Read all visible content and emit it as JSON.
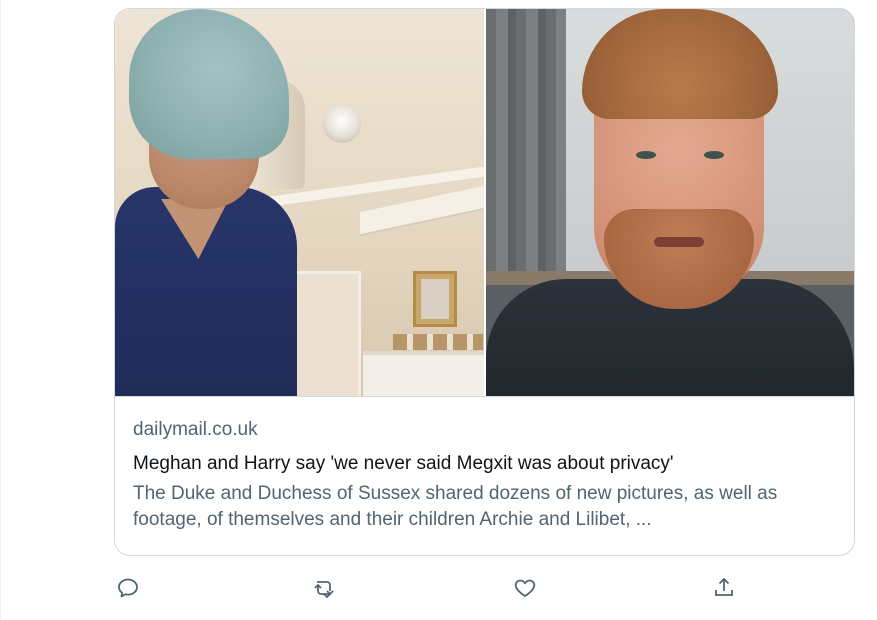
{
  "tweet": {
    "card": {
      "domain": "dailymail.co.uk",
      "headline": "Meghan and Harry say 'we never said Megxit was about privacy'",
      "description": "The Duke and Duchess of Sussex shared dozens of new pictures, as well as footage, of themselves and their children Archie and Lilibet, ...",
      "images": [
        {
          "semantic": "woman-with-towel-photo"
        },
        {
          "semantic": "man-with-beard-photo"
        }
      ]
    },
    "actions": [
      {
        "name": "reply",
        "icon": "reply-icon"
      },
      {
        "name": "retweet",
        "icon": "retweet-icon"
      },
      {
        "name": "like",
        "icon": "heart-icon"
      },
      {
        "name": "share",
        "icon": "share-icon"
      }
    ]
  },
  "colors": {
    "border": "#cfd9de",
    "secondary_text": "#536471",
    "primary_text": "#0f1419"
  }
}
